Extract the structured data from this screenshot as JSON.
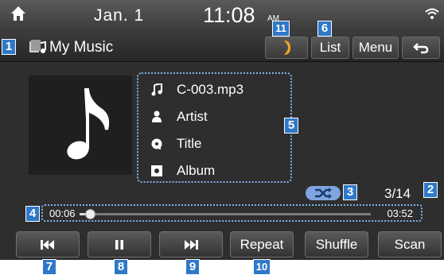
{
  "status_bar": {
    "date": "Jan.  1",
    "time": "11:08",
    "ampm": "AM",
    "icons": {
      "home": "home-icon",
      "signal": "wifi-signal-icon"
    }
  },
  "title_bar": {
    "source_title": "My Music",
    "source_icon": "music-source-icon",
    "list_label": "List",
    "menu_label": "Menu",
    "back_icon": "back-arrow-icon",
    "phone_icon": "phone-projection-icon"
  },
  "track_info": {
    "file_name": "C-003.mp3",
    "artist": "Artist",
    "title": "Title",
    "album": "Album"
  },
  "playback": {
    "track_counter": "3/14",
    "elapsed": "00:06",
    "total": "03:52",
    "progress_fraction": 0.035,
    "shuffle_on": true
  },
  "controls": {
    "prev_icon": "skip-previous-icon",
    "pause_icon": "pause-icon",
    "next_icon": "skip-next-icon",
    "repeat_label": "Repeat",
    "shuffle_label": "Shuffle",
    "scan_label": "Scan"
  },
  "callouts": {
    "c1": "1",
    "c2": "2",
    "c3": "3",
    "c4": "4",
    "c5": "5",
    "c6": "6",
    "c7": "7",
    "c8": "8",
    "c9": "9",
    "c10": "10",
    "c11": "11"
  },
  "colors": {
    "callout": "#2f78c8",
    "highlight_border": "#7fb4e6",
    "shuffle_badge": "#7fa5e0",
    "phone_icon": "#f5a623"
  }
}
